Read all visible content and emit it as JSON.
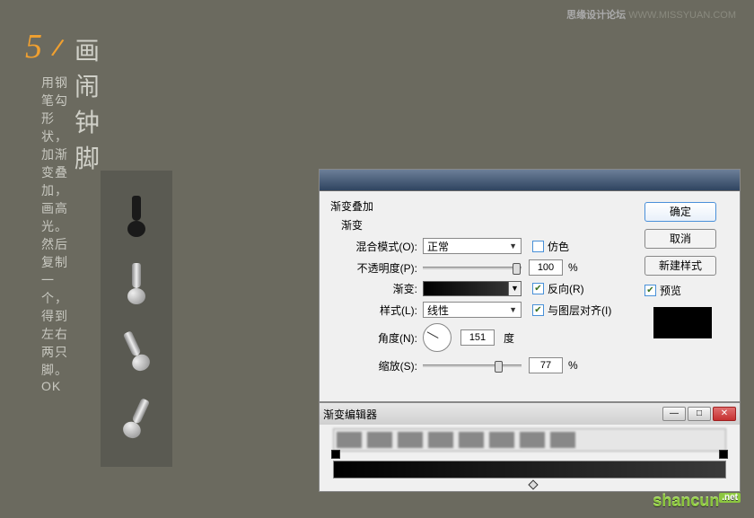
{
  "header": {
    "site_name": "思缘设计论坛",
    "site_url": "WWW.MISSYUAN.COM"
  },
  "step": {
    "number": "5",
    "title": "画闹钟脚",
    "description": "用钢笔勾形状，加渐变叠加，画高光。然后复制一个，得到左右两只脚。OK"
  },
  "dialog": {
    "section": "渐变叠加",
    "subsection": "渐变",
    "blend_mode": {
      "label": "混合模式(O):",
      "value": "正常"
    },
    "dither": {
      "label": "仿色"
    },
    "opacity": {
      "label": "不透明度(P):",
      "value": "100",
      "unit": "%"
    },
    "gradient": {
      "label": "渐变:"
    },
    "reverse": {
      "label": "反向(R)"
    },
    "style": {
      "label": "样式(L):",
      "value": "线性"
    },
    "align": {
      "label": "与图层对齐(I)"
    },
    "angle": {
      "label": "角度(N):",
      "value": "151",
      "unit": "度"
    },
    "scale": {
      "label": "缩放(S):",
      "value": "77",
      "unit": "%"
    },
    "buttons": {
      "ok": "确定",
      "cancel": "取消",
      "new_style": "新建样式"
    },
    "preview_label": "预览"
  },
  "gradient_editor": {
    "title": "渐变编辑器"
  },
  "watermark": {
    "name": "shancun",
    "ext": ".net"
  }
}
